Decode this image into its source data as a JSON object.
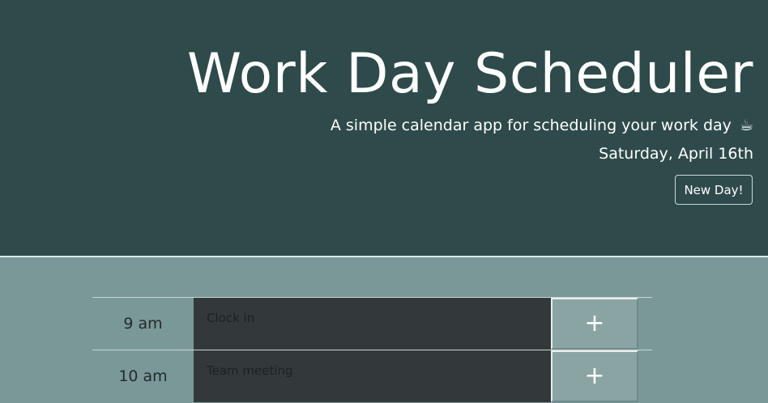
{
  "header": {
    "title": "Work Day Scheduler",
    "subtitle": "A simple calendar app for scheduling your work day",
    "subtitle_icon": "☕",
    "date": "Saturday, April 16th",
    "new_day_label": "New Day!"
  },
  "schedule": {
    "rows": [
      {
        "hour": "9 am",
        "task": "Clock in",
        "add_label": "+"
      },
      {
        "hour": "10 am",
        "task": "Team meeting",
        "add_label": "+"
      }
    ]
  },
  "colors": {
    "header_bg": "#2e4a4a",
    "body_bg": "#7a9898",
    "task_bg": "#33393b",
    "button_bg": "#8aa4a4"
  }
}
